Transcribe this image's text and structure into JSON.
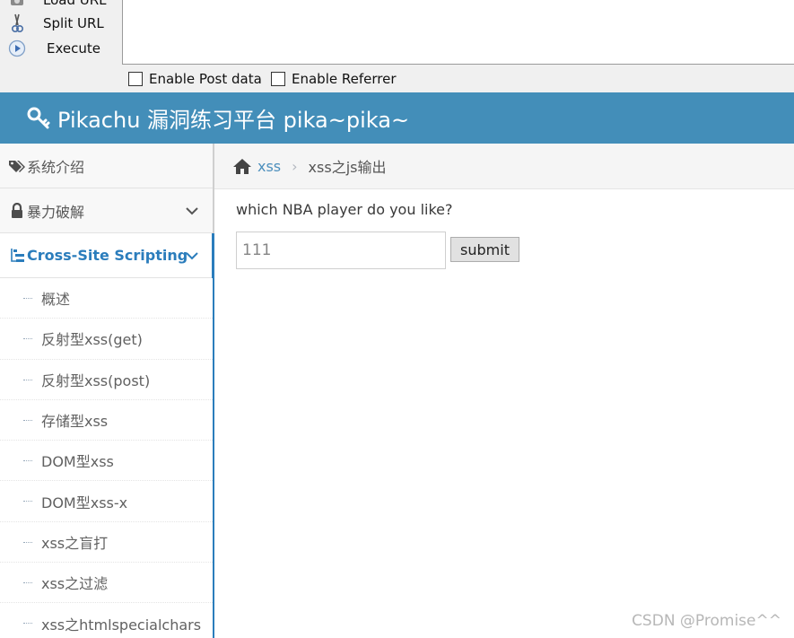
{
  "hackbar": {
    "load_label": "Load URL",
    "split_label": "Split URL",
    "execute_label": "Execute",
    "url_value": "",
    "post_label": "Enable Post data",
    "referrer_label": "Enable Referrer"
  },
  "banner": {
    "title": "Pikachu 漏洞练习平台 pika~pika~"
  },
  "sidebar": {
    "items": [
      {
        "label": "系统介绍"
      },
      {
        "label": "暴力破解"
      },
      {
        "label": "Cross-Site Scripting"
      }
    ],
    "subitems": [
      "概述",
      "反射型xss(get)",
      "反射型xss(post)",
      "存储型xss",
      "DOM型xss",
      "DOM型xss-x",
      "xss之盲打",
      "xss之过滤",
      "xss之htmlspecialchars"
    ]
  },
  "breadcrumb": {
    "link": "xss",
    "separator": "›",
    "current": "xss之js输出"
  },
  "main": {
    "question": "which NBA player do you like?",
    "input_value": "111",
    "submit_label": "submit"
  },
  "watermark": "CSDN @Promise^^",
  "colors": {
    "banner": "#438eb9",
    "accent": "#2b7dbc"
  }
}
